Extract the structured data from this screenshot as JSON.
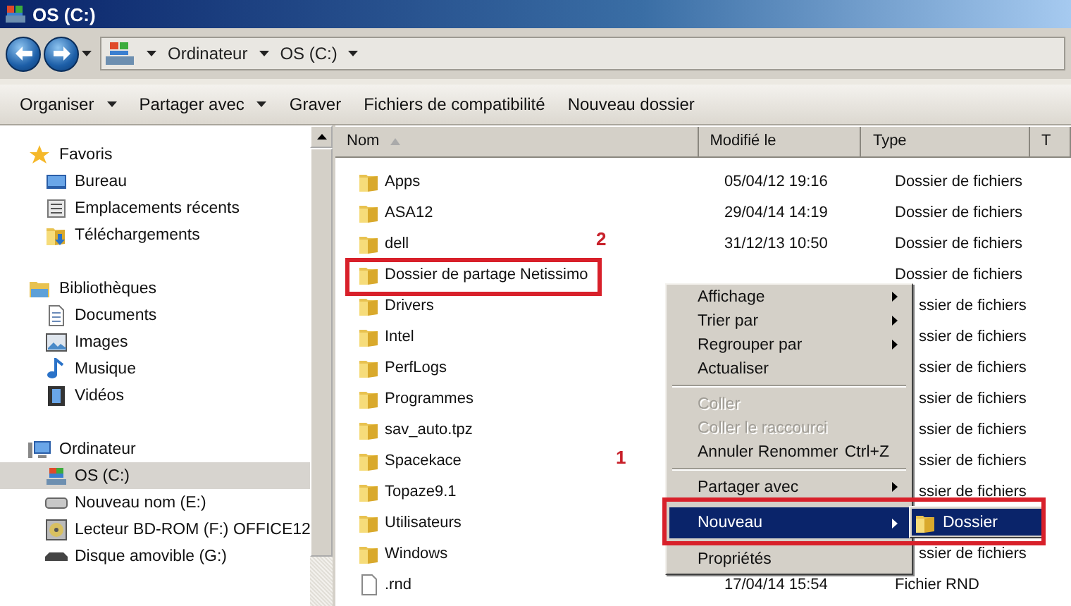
{
  "window": {
    "title": "OS (C:)"
  },
  "address_bar": {
    "crumbs": [
      "Ordinateur",
      "OS (C:)"
    ]
  },
  "toolbar": [
    {
      "label": "Organiser",
      "dropdown": true
    },
    {
      "label": "Partager avec",
      "dropdown": true
    },
    {
      "label": "Graver",
      "dropdown": false
    },
    {
      "label": "Fichiers de compatibilité",
      "dropdown": false
    },
    {
      "label": "Nouveau dossier",
      "dropdown": false
    }
  ],
  "sidebar": {
    "groups": [
      {
        "label": "Favoris",
        "children": [
          {
            "label": "Bureau",
            "selected": false
          },
          {
            "label": "Emplacements récents",
            "selected": false
          },
          {
            "label": "Téléchargements",
            "selected": false
          }
        ]
      },
      {
        "label": "Bibliothèques",
        "children": [
          {
            "label": "Documents",
            "selected": false
          },
          {
            "label": "Images",
            "selected": false
          },
          {
            "label": "Musique",
            "selected": false
          },
          {
            "label": "Vidéos",
            "selected": false
          }
        ]
      },
      {
        "label": "Ordinateur",
        "children": [
          {
            "label": "OS (C:)",
            "selected": true
          },
          {
            "label": "Nouveau nom (E:)",
            "selected": false
          },
          {
            "label": "Lecteur BD-ROM (F:) OFFICE12",
            "selected": false
          },
          {
            "label": "Disque amovible (G:)",
            "selected": false
          }
        ]
      }
    ]
  },
  "table": {
    "columns": [
      {
        "label": "Nom",
        "sorted": true
      },
      {
        "label": "Modifié le",
        "sorted": false
      },
      {
        "label": "Type",
        "sorted": false
      },
      {
        "label": "T",
        "sorted": false
      }
    ],
    "rows": [
      {
        "kind": "folder",
        "name": "Apps",
        "modified": "05/04/12 19:16",
        "type": "Dossier de fichiers",
        "type_cut": false
      },
      {
        "kind": "folder",
        "name": "ASA12",
        "modified": "29/04/14 14:19",
        "type": "Dossier de fichiers",
        "type_cut": false
      },
      {
        "kind": "folder",
        "name": "dell",
        "modified": "31/12/13 10:50",
        "type": "Dossier de fichiers",
        "type_cut": false
      },
      {
        "kind": "folder",
        "name": "Dossier de partage Netissimo",
        "type": "Dossier de fichiers",
        "type_cut": false
      },
      {
        "kind": "folder",
        "name": "Drivers",
        "type": "ssier de fichiers",
        "type_cut": true
      },
      {
        "kind": "folder",
        "name": "Intel",
        "type": "ssier de fichiers",
        "type_cut": true
      },
      {
        "kind": "folder",
        "name": "PerfLogs",
        "type": "ssier de fichiers",
        "type_cut": true
      },
      {
        "kind": "folder",
        "name": "Programmes",
        "type": "ssier de fichiers",
        "type_cut": true
      },
      {
        "kind": "folder",
        "name": "sav_auto.tpz",
        "type": "ssier de fichiers",
        "type_cut": true
      },
      {
        "kind": "folder",
        "name": "Spacekace",
        "type": "ssier de fichiers",
        "type_cut": true
      },
      {
        "kind": "folder",
        "name": "Topaze9.1",
        "type": "ssier de fichiers",
        "type_cut": true
      },
      {
        "kind": "folder",
        "name": "Utilisateurs"
      },
      {
        "kind": "folder",
        "name": "Windows",
        "type": "ssier de fichiers",
        "type_cut": true
      },
      {
        "kind": "file",
        "name": ".rnd",
        "modified": "17/04/14 15:54",
        "type": "Fichier RND",
        "type_cut": false
      }
    ]
  },
  "context_menu": {
    "items": [
      {
        "kind": "item",
        "label": "Affichage",
        "submenu": true,
        "disabled": false,
        "selected": false
      },
      {
        "kind": "item",
        "label": "Trier par",
        "submenu": true,
        "disabled": false,
        "selected": false
      },
      {
        "kind": "item",
        "label": "Regrouper par",
        "submenu": true,
        "disabled": false,
        "selected": false
      },
      {
        "kind": "item",
        "label": "Actualiser",
        "disabled": false,
        "selected": false
      },
      {
        "kind": "separator"
      },
      {
        "kind": "item",
        "label": "Coller",
        "disabled": true,
        "selected": false
      },
      {
        "kind": "item",
        "label": "Coller le raccourci",
        "disabled": true,
        "selected": false
      },
      {
        "kind": "item",
        "label": "Annuler Renommer",
        "shortcut": "Ctrl+Z",
        "disabled": false,
        "selected": false
      },
      {
        "kind": "separator"
      },
      {
        "kind": "item",
        "label": "Partager avec",
        "submenu": true,
        "disabled": false,
        "selected": false
      },
      {
        "kind": "item",
        "label": "Nouveau",
        "submenu": true,
        "disabled": false,
        "selected": true
      },
      {
        "kind": "item",
        "label": "Propriétés",
        "disabled": false,
        "selected": false
      }
    ],
    "submenu": {
      "items": [
        {
          "label": "Dossier",
          "selected": true
        }
      ]
    }
  },
  "annotations": [
    {
      "kind": "row-frame",
      "label": "2"
    },
    {
      "kind": "menu-frame",
      "label": "1"
    }
  ]
}
